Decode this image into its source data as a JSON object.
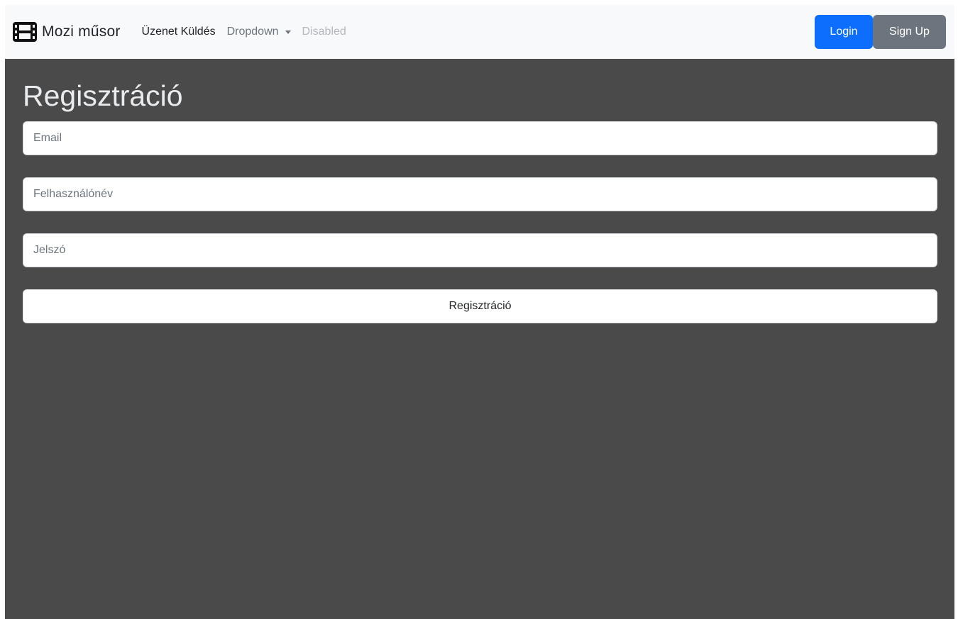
{
  "navbar": {
    "brand_text": "Mozi műsor",
    "brand_icon": "film-icon",
    "links": [
      {
        "label": "Üzenet Küldés",
        "state": "active"
      },
      {
        "label": "Dropdown",
        "state": "normal",
        "has_caret": true
      },
      {
        "label": "Disabled",
        "state": "disabled"
      }
    ],
    "login_label": "Login",
    "signup_label": "Sign Up"
  },
  "form": {
    "title": "Regisztráció",
    "email_placeholder": "Email",
    "username_placeholder": "Felhasználónév",
    "password_placeholder": "Jelszó",
    "submit_label": "Regisztráció"
  },
  "colors": {
    "navbar_bg": "#f8f9fa",
    "page_bg": "#4a4a4a",
    "login_button": "#0d6efd",
    "signup_button": "#6c757d"
  }
}
